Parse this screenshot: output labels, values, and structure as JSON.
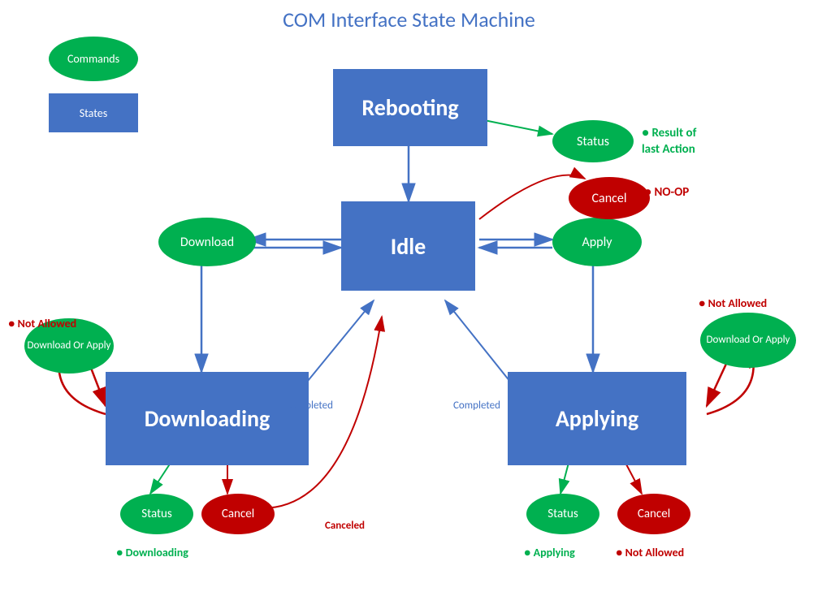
{
  "title": "COM Interface State Machine",
  "legend": {
    "commands_label": "Commands",
    "states_label": "States"
  },
  "states": {
    "rebooting": "Rebooting",
    "idle": "Idle",
    "downloading": "Downloading",
    "applying": "Applying"
  },
  "commands": {
    "download": "Download",
    "apply": "Apply",
    "download_or_apply_left": "Download Or Apply",
    "download_or_apply_right": "Download Or Apply",
    "status_top": "Status",
    "cancel_top": "Cancel",
    "status_downloading": "Status",
    "cancel_downloading": "Cancel",
    "status_applying": "Status",
    "cancel_applying": "Cancel"
  },
  "labels": {
    "result_of_last_action": "Result of\nlast Action",
    "no_op": "NO-OP",
    "not_allowed_left": "Not Allowed",
    "not_allowed_right": "Not Allowed",
    "completed_left": "Completed",
    "completed_right": "Completed",
    "canceled": "Canceled",
    "downloading_status": "Downloading",
    "applying_status": "Applying",
    "not_allowed_applying": "Not Allowed"
  }
}
